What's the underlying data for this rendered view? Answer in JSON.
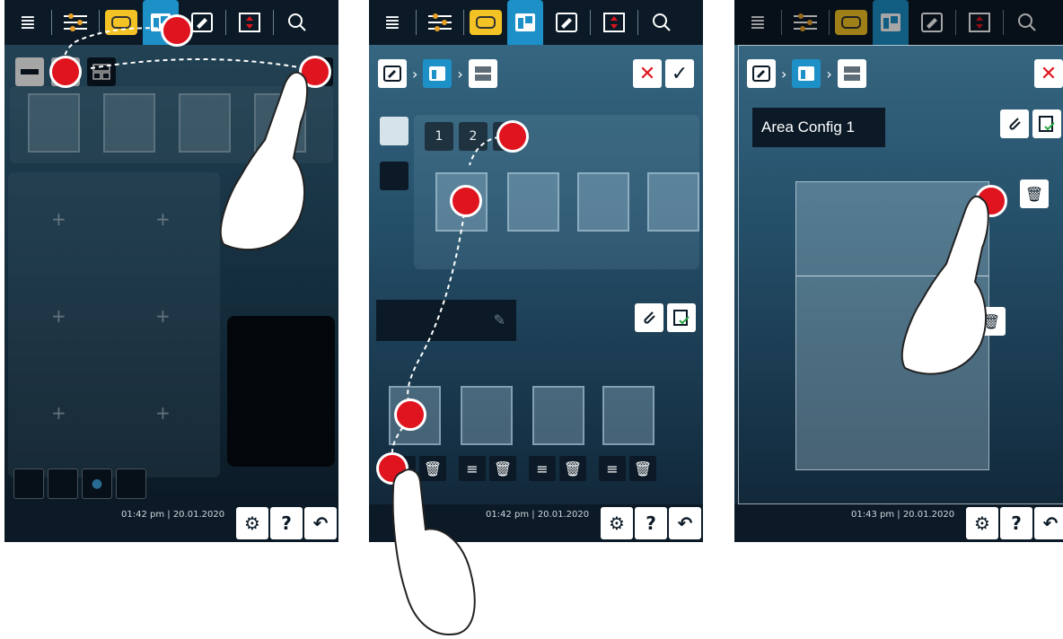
{
  "screens": [
    {
      "clock": "01:42 pm | 20.01.2020"
    },
    {
      "clock": "01:42 pm | 20.01.2020",
      "tab_1": "1",
      "tab_2": "2"
    },
    {
      "clock": "01:43 pm | 20.01.2020",
      "config_name": "Area Config 1"
    }
  ],
  "icons": {
    "menu": "≣",
    "help": "?",
    "back": "↶",
    "settings": "⚙",
    "close": "✕",
    "confirm": "✓",
    "trash": "🗑",
    "chevron": "›"
  },
  "colors": {
    "accent": "#1d90c8",
    "marker": "#e0141e",
    "highlight": "#f3c326"
  }
}
